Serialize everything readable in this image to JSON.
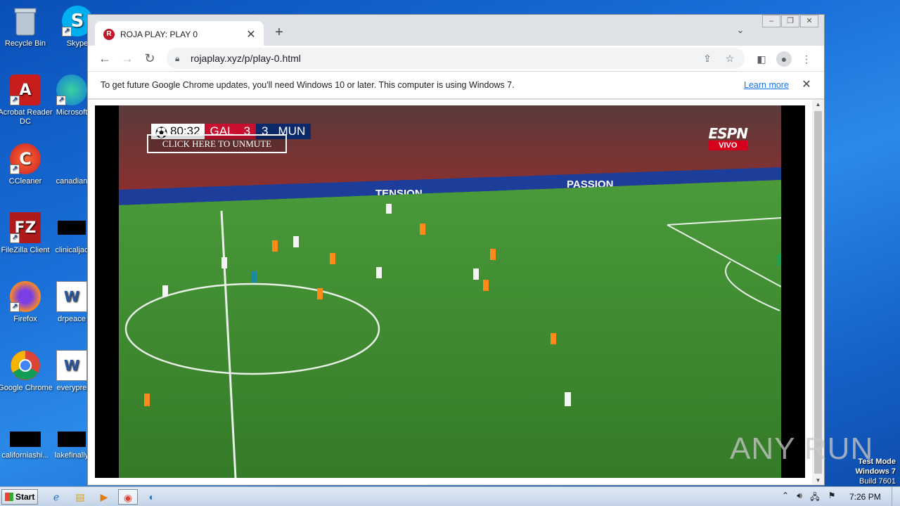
{
  "desktop": {
    "icons": [
      {
        "label": "Recycle Bin"
      },
      {
        "label": "Skype"
      },
      {
        "label": "Acrobat Reader DC"
      },
      {
        "label": "Microsoft"
      },
      {
        "label": "CCleaner"
      },
      {
        "label": "canadian"
      },
      {
        "label": "FileZilla Client"
      },
      {
        "label": "clinicaljac"
      },
      {
        "label": "Firefox"
      },
      {
        "label": "drpeace"
      },
      {
        "label": "Google Chrome"
      },
      {
        "label": "everypre"
      },
      {
        "label": "californiashi..."
      },
      {
        "label": "lakefinally"
      }
    ],
    "watermark": {
      "line1": "Test Mode",
      "line2": "Windows 7",
      "line3": "Build 7601"
    }
  },
  "browser": {
    "tab_title": "ROJA PLAY: PLAY 0",
    "tab_favicon": "R",
    "url": "rojaplay.xyz/p/play-0.html",
    "infobar": {
      "message": "To get future Google Chrome updates, you'll need Windows 10 or later. This computer is using Windows 7.",
      "link": "Learn more"
    }
  },
  "video": {
    "unmute_label": "CLICK HERE TO UNMUTE",
    "scorebug": {
      "clock": "80:32",
      "home": "GAL",
      "home_score": "3",
      "away_score": "3",
      "away": "MUN"
    },
    "broadcaster": "ESPN",
    "broadcaster_tag": "VIVO",
    "board_texts": [
      "TENSION",
      "PASSION"
    ]
  },
  "overlay_watermark": "ANY RUN",
  "taskbar": {
    "start_label": "Start",
    "time": "7:26 PM"
  },
  "colors": {
    "chrome_tab_bg": "#dee1e6",
    "link": "#1a73e8",
    "pitch": "#3a8a2e"
  }
}
